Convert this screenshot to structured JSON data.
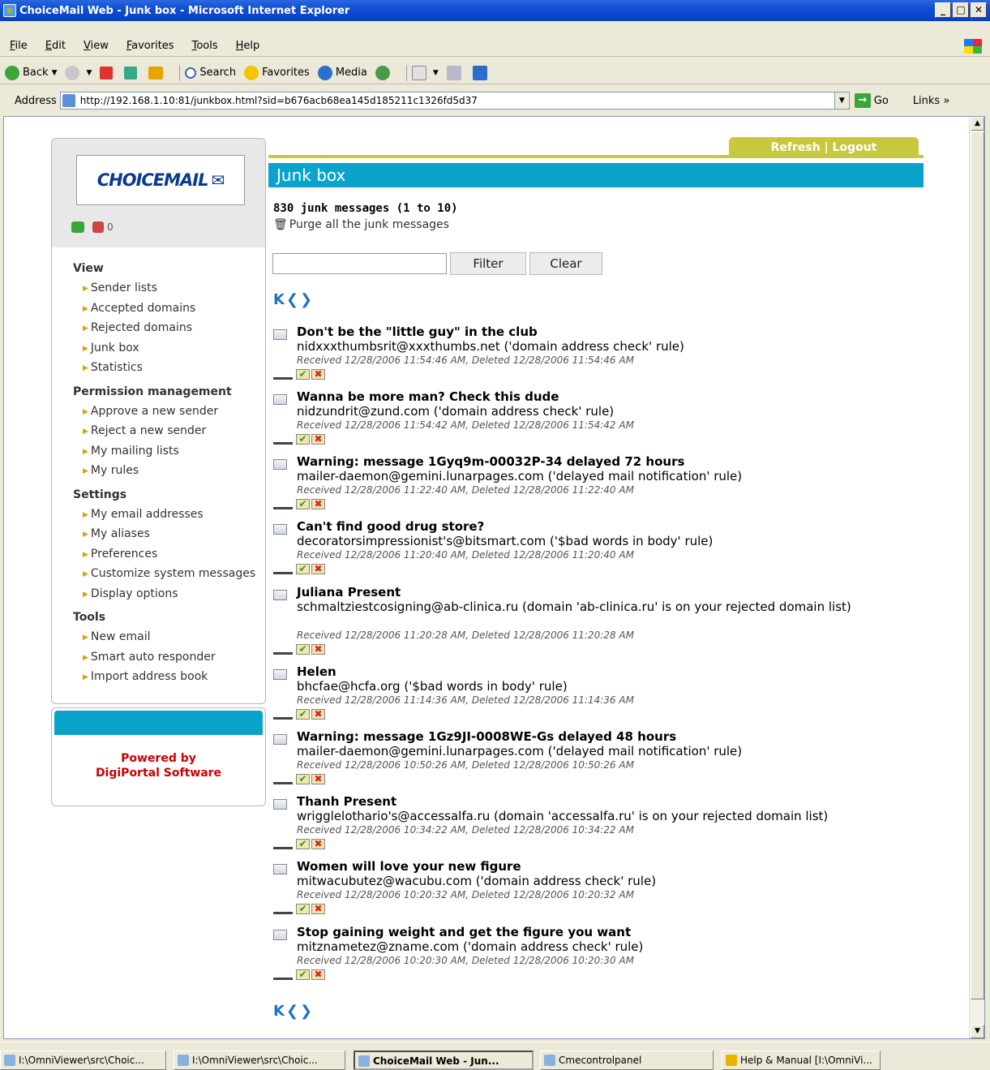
{
  "window": {
    "title": "ChoiceMail Web - Junk box - Microsoft Internet Explorer",
    "buttons": [
      "_",
      "□",
      "✕"
    ]
  },
  "menu": [
    "File",
    "Edit",
    "View",
    "Favorites",
    "Tools",
    "Help"
  ],
  "toolbar": {
    "back": "Back",
    "search": "Search",
    "favorites": "Favorites",
    "media": "Media"
  },
  "address": {
    "label": "Address",
    "url": "http://192.168.1.10:81/junkbox.html?sid=b676acb68ea145d185211c1326fd5d37",
    "go": "Go",
    "links": "Links"
  },
  "sidebar": {
    "logo_text": "CHOICEMAIL",
    "status_count": "0",
    "sections": [
      {
        "title": "View",
        "items": [
          "Sender lists",
          "Accepted domains",
          "Rejected domains",
          "Junk box",
          "Statistics"
        ]
      },
      {
        "title": "Permission management",
        "items": [
          "Approve a new sender",
          "Reject a new sender",
          "My mailing lists",
          "My rules"
        ]
      },
      {
        "title": "Settings",
        "items": [
          "My email addresses",
          "My aliases",
          "Preferences",
          "Customize system messages",
          "Display options"
        ]
      },
      {
        "title": "Tools",
        "items": [
          "New email",
          "Smart auto responder",
          "Import address book"
        ]
      }
    ],
    "powered_line1": "Powered by",
    "powered_line2": "DigiPortal Software"
  },
  "main": {
    "top_links": "Refresh | Logout",
    "heading": "Junk box",
    "count_text": "830 junk messages (1 to 10)",
    "purge_text": "Purge all the junk messages",
    "filter_placeholder": "",
    "filter_button": "Filter",
    "clear_button": "Clear",
    "pager": [
      "K",
      "❮",
      "❯"
    ],
    "messages": [
      {
        "subject": "Don't be the \"little guy\" in the club",
        "from": "nidxxxthumbsrit@xxxthumbs.net ('domain address check' rule)",
        "received": "Received 12/28/2006 11:54:46 AM, Deleted 12/28/2006 11:54:46 AM"
      },
      {
        "subject": "Wanna be more man? Check this dude",
        "from": "nidzundrit@zund.com ('domain address check' rule)",
        "received": "Received 12/28/2006 11:54:42 AM, Deleted 12/28/2006 11:54:42 AM"
      },
      {
        "subject": "Warning: message 1Gyq9m-00032P-34 delayed 72 hours",
        "from": "mailer-daemon@gemini.lunarpages.com ('delayed mail notification' rule)",
        "received": "Received 12/28/2006 11:22:40 AM, Deleted 12/28/2006 11:22:40 AM"
      },
      {
        "subject": "Can't find good drug store?",
        "from": "decoratorsimpressionist's@bitsmart.com ('$bad words in body' rule)",
        "received": "Received 12/28/2006 11:20:40 AM, Deleted 12/28/2006 11:20:40 AM"
      },
      {
        "subject": "Juliana Present",
        "from": "schmaltziestcosigning@ab-clinica.ru (domain 'ab-clinica.ru' is on your rejected domain list)",
        "received": "Received 12/28/2006 11:20:28 AM, Deleted 12/28/2006 11:20:28 AM"
      },
      {
        "subject": "Helen",
        "from": "bhcfae@hcfa.org ('$bad words in body' rule)",
        "received": "Received 12/28/2006 11:14:36 AM, Deleted 12/28/2006 11:14:36 AM"
      },
      {
        "subject": "Warning: message 1Gz9JI-0008WE-Gs delayed 48 hours",
        "from": "mailer-daemon@gemini.lunarpages.com ('delayed mail notification' rule)",
        "received": "Received 12/28/2006 10:50:26 AM, Deleted 12/28/2006 10:50:26 AM"
      },
      {
        "subject": "Thanh Present",
        "from": "wrigglelothario's@accessalfa.ru (domain 'accessalfa.ru' is on your rejected domain list)",
        "received": "Received 12/28/2006 10:34:22 AM, Deleted 12/28/2006 10:34:22 AM"
      },
      {
        "subject": "Women will love your new figure",
        "from": "mitwacubutez@wacubu.com ('domain address check' rule)",
        "received": "Received 12/28/2006 10:20:32 AM, Deleted 12/28/2006 10:20:32 AM"
      },
      {
        "subject": "Stop gaining weight and get the figure you want",
        "from": "mitznametez@zname.com ('domain address check' rule)",
        "received": "Received 12/28/2006 10:20:30 AM, Deleted 12/28/2006 10:20:30 AM"
      }
    ]
  },
  "taskbar": {
    "tasks": [
      "I:\\OmniViewer\\src\\Choic...",
      "I:\\OmniViewer\\src\\Choic...",
      "ChoiceMail Web - Jun...",
      "Cmecontrolpanel",
      "Help & Manual [I:\\OmniVi..."
    ]
  }
}
